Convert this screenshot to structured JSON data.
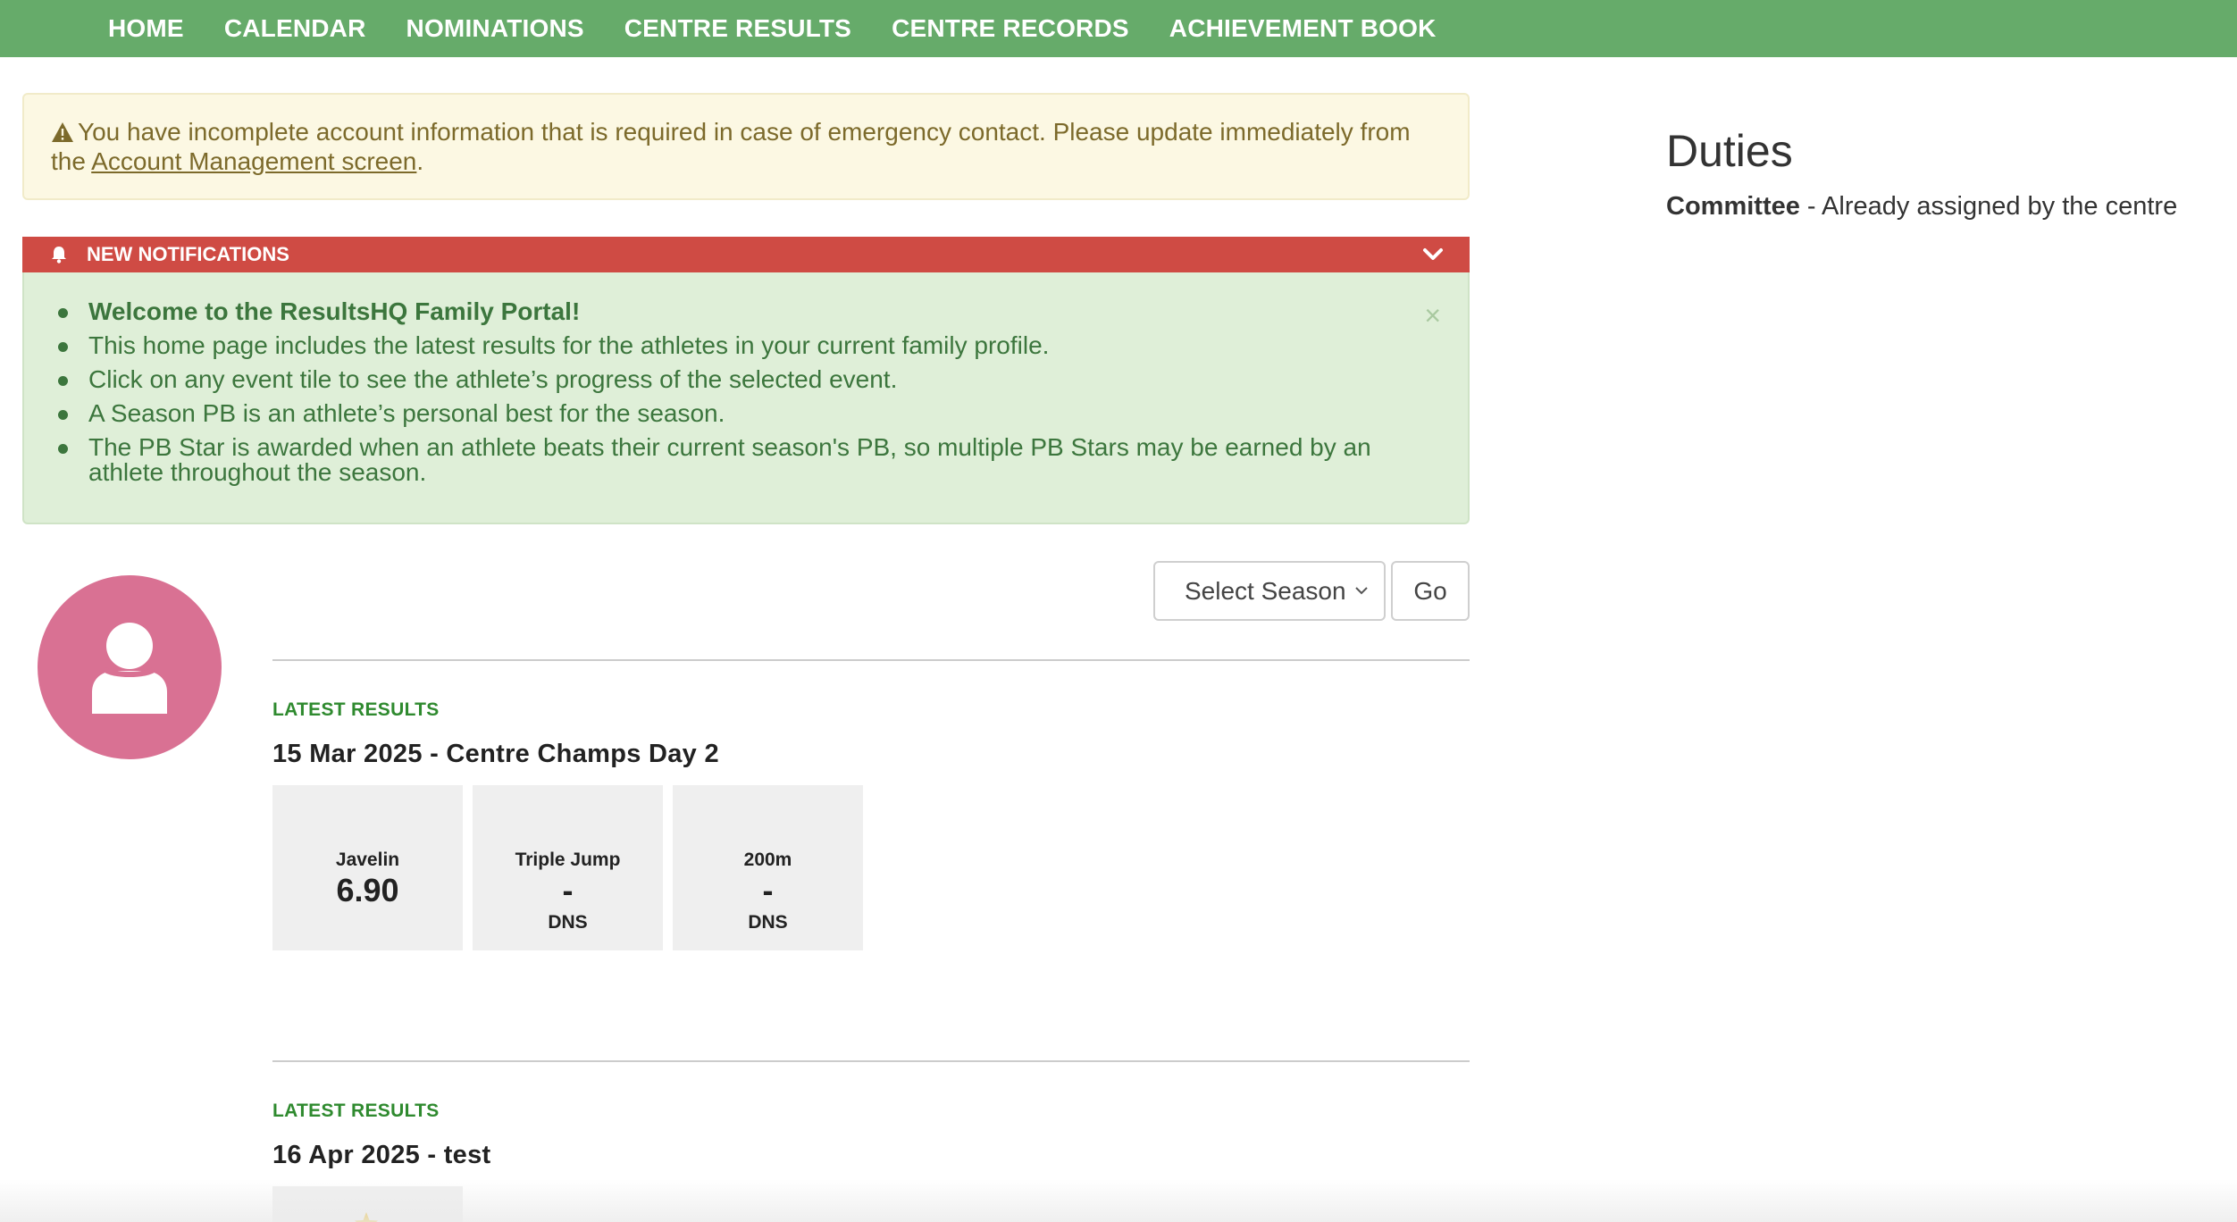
{
  "nav": {
    "items": [
      "HOME",
      "CALENDAR",
      "NOMINATIONS",
      "CENTRE RESULTS",
      "CENTRE RECORDS",
      "ACHIEVEMENT BOOK"
    ]
  },
  "warning": {
    "text": "You have incomplete account information that is required in case of emergency contact. Please update immediately from the ",
    "link_text": "Account Management screen",
    "suffix": "."
  },
  "notifications": {
    "header": "NEW NOTIFICATIONS",
    "close_symbol": "×",
    "items": [
      "Welcome to the ResultsHQ Family Portal!",
      "This home page includes the latest results for the athletes in your current family profile.",
      "Click on any event tile to see the athlete’s progress of the selected event.",
      "A Season PB is an athlete’s personal best for the season.",
      "The PB Star is awarded when an athlete beats their current season's PB, so multiple PB Stars may be earned by an athlete throughout the season."
    ]
  },
  "season": {
    "selected": "Select Season",
    "go_label": "Go"
  },
  "results": [
    {
      "label": "LATEST RESULTS",
      "meet": "15 Mar 2025 - Centre Champs Day 2",
      "tiles": [
        {
          "event": "Javelin",
          "value": "6.90",
          "status": ""
        },
        {
          "event": "Triple Jump",
          "value": "-",
          "status": "DNS"
        },
        {
          "event": "200m",
          "value": "-",
          "status": "DNS"
        }
      ]
    },
    {
      "label": "LATEST RESULTS",
      "meet": "16 Apr 2025 - test",
      "tiles": []
    }
  ],
  "duties": {
    "title": "Duties",
    "role": "Committee",
    "detail": " - Already assigned by the centre"
  },
  "colors": {
    "nav_bg": "#66ab6a",
    "notif_header": "#cf4b44",
    "notif_body": "#dfefd8",
    "warning_bg": "#fcf8e3",
    "avatar": "#d97193",
    "label_green": "#2f8a2f"
  },
  "icons": [
    "warning-icon",
    "bell-icon",
    "chevron-down-icon",
    "close-icon",
    "user-icon",
    "star-icon"
  ]
}
